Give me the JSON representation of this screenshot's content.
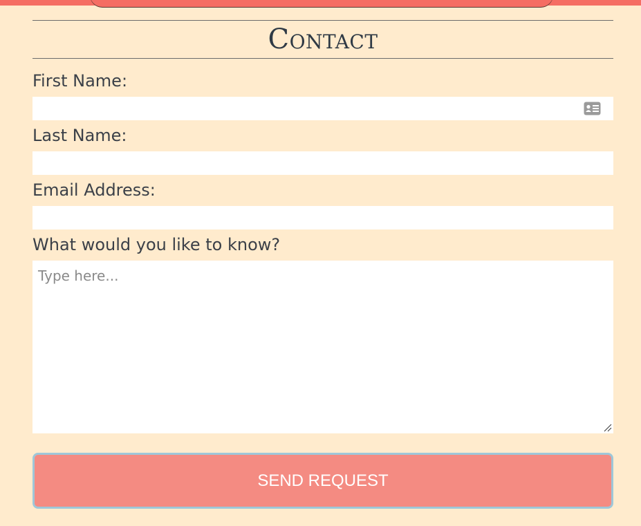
{
  "form": {
    "title": "Contact",
    "first_name_label": "First Name:",
    "last_name_label": "Last Name:",
    "email_label": "Email Address:",
    "message_label": "What would you like to know?",
    "message_placeholder": "Type here...",
    "submit_label": "SEND REQUEST"
  },
  "colors": {
    "background": "#FFEBCD",
    "accent": "#F56D63",
    "button": "#F48B82",
    "button_border": "#9FC7D8"
  },
  "icons": {
    "autofill": "contact-card-icon",
    "resize": "resize-grip-icon"
  }
}
